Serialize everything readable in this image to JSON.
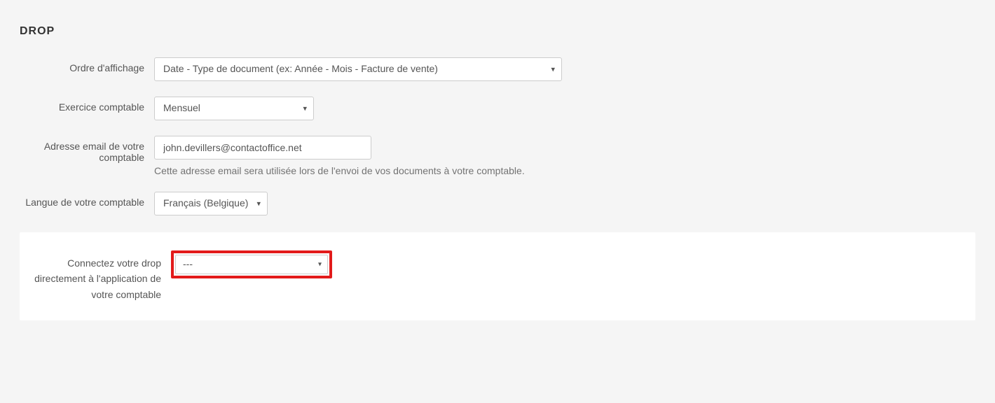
{
  "section": {
    "title": "DROP"
  },
  "form": {
    "display_order": {
      "label": "Ordre d'affichage",
      "value": "Date - Type de document (ex: Année - Mois - Facture de vente)"
    },
    "fiscal_year": {
      "label": "Exercice comptable",
      "value": "Mensuel"
    },
    "accountant_email": {
      "label": "Adresse email de votre comptable",
      "value": "john.devillers@contactoffice.net",
      "help": "Cette adresse email sera utilisée lors de l'envoi de vos documents à votre comptable."
    },
    "accountant_language": {
      "label": "Langue de votre comptable",
      "value": "Français (Belgique)"
    },
    "connect_drop": {
      "label": "Connectez votre drop directement à l'application de votre comptable",
      "value": "---"
    }
  }
}
